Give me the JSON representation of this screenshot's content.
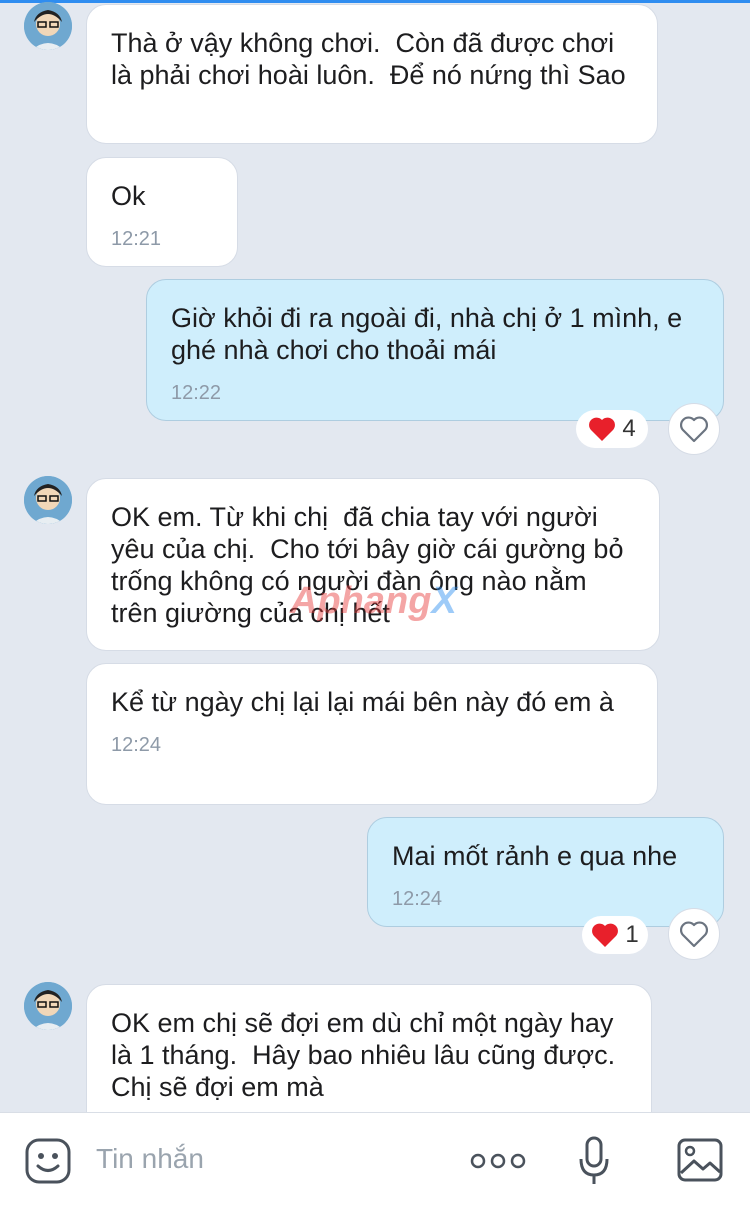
{
  "messages": [
    {
      "side": "in",
      "text": "Thà ở vậy không chơi.  Còn đã được chơi là phải chơi hoài luôn.  Để nó nứng thì Sao",
      "time": ""
    },
    {
      "side": "in",
      "text": "Ok",
      "time": "12:21"
    },
    {
      "side": "out",
      "text": "Giờ khỏi đi ra ngoài đi, nhà chị ở 1 mình, e ghé nhà chơi cho thoải mái",
      "time": "12:22",
      "reaction_count": "4"
    },
    {
      "side": "in",
      "text": "OK em. Từ khi chị  đã chia tay với người yêu của chị.  Cho tới bây giờ cái gường bỏ trống không có người đàn ông nào nằm trên giường của chị hết",
      "time": ""
    },
    {
      "side": "in",
      "text": "Kể từ ngày chị lại lại mái bên này đó em à",
      "time": "12:24"
    },
    {
      "side": "out",
      "text": "Mai mốt rảnh e qua nhe",
      "time": "12:24",
      "reaction_count": "1"
    },
    {
      "side": "in",
      "text": "OK em chị sẽ đợi em dù chỉ một ngày hay là 1 tháng.  Hây bao nhiêu lâu cũng được.  Chị sẽ đợi em mà",
      "time": ""
    }
  ],
  "watermark": "AphangX",
  "composer": {
    "placeholder": "Tin nhắn",
    "icons": [
      "sticker-icon",
      "more-icon",
      "microphone-icon",
      "image-icon"
    ]
  },
  "colors": {
    "background": "#e3e8f0",
    "incoming_bubble": "#ffffff",
    "outgoing_bubble": "#cfeefc",
    "heart": "#e8202b"
  }
}
